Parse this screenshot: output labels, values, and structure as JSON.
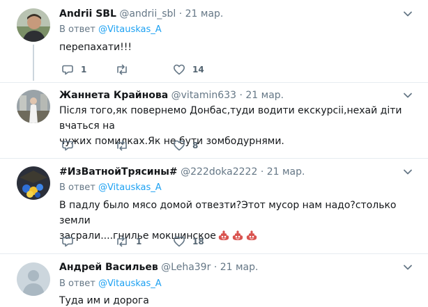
{
  "tweets": [
    {
      "name": "Andrii SBL",
      "handle": "@andrii_sbl",
      "dot": "·",
      "time": "21 мар.",
      "reply_prefix": "В ответ",
      "reply_mention": "@Vitauskas_A",
      "text": "перепахати!!!",
      "replies": "1",
      "retweets": "",
      "likes": "14"
    },
    {
      "name": "Жаннета Крайнова",
      "handle": "@vitamin633",
      "dot": "·",
      "time": "21 мар.",
      "text_line1": "Після того,як повернемо Донбас,туди водити екскурсіі,нехай діти вчаться на",
      "text_line2": "чужих помилках.Як не бути зомбодурнями.",
      "replies": "",
      "retweets": "",
      "likes": "8"
    },
    {
      "name": "#ИзВатнойТрясины#",
      "handle": "@222doka2222",
      "dot": "·",
      "time": "21 мар.",
      "reply_prefix": "В ответ",
      "reply_mention": "@Vitauskas_A",
      "text_line1": "В падлу было мясо домой отвезти?Этот мусор нам надо?столько земли",
      "text_line2": "засрали....гнилье мокшинское",
      "replies": "",
      "retweets": "1",
      "likes": "18"
    },
    {
      "name": "Андрей Васильев",
      "handle": "@Leha39r",
      "dot": "·",
      "time": "21 мар.",
      "reply_prefix": "В ответ",
      "reply_mention": "@Vitauskas_A",
      "text": "Туда им и дорога"
    }
  ],
  "colors": {
    "text": "#14171a",
    "secondary": "#657786",
    "link": "#1da1f2",
    "divider": "#e6ecf0",
    "thread_line": "#ccd6dd"
  }
}
